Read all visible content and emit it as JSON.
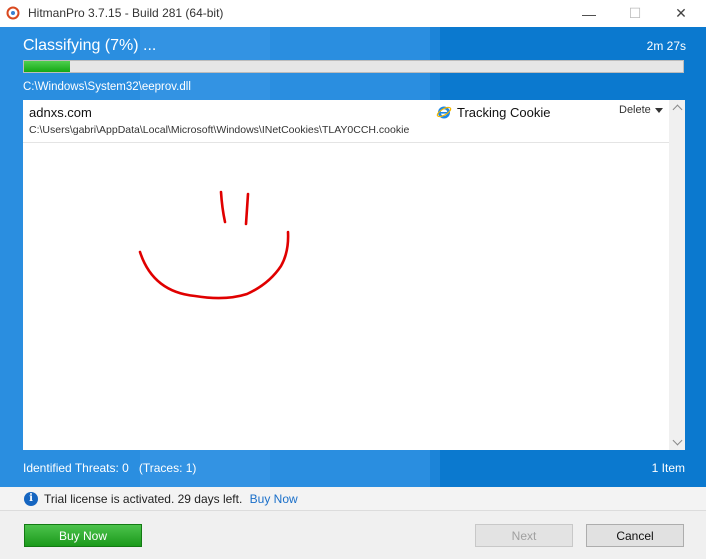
{
  "window": {
    "title": "HitmanPro 3.7.15 - Build 281 (64-bit)",
    "minimize_glyph": "—",
    "maximize_glyph": "☐",
    "close_glyph": "✕"
  },
  "scan": {
    "status": "Classifying (7%) ...",
    "progress_percent": 7,
    "time_remaining": "2m 27s",
    "current_file": "C:\\Windows\\System32\\eeprov.dll"
  },
  "results": [
    {
      "name": "adnxs.com",
      "path": "C:\\Users\\gabri\\AppData\\Local\\Microsoft\\Windows\\INetCookies\\TLAY0CCH.cookie",
      "type": "Tracking Cookie",
      "type_icon": "internet-explorer-icon",
      "action": "Delete"
    }
  ],
  "summary": {
    "threats": "Identified Threats: 0   (Traces: 1)",
    "item_count": "1 Item"
  },
  "notice": {
    "text": "Trial license is activated. 29 days left.",
    "link": "Buy Now",
    "icon": "info-icon"
  },
  "footer": {
    "buy_now": "Buy Now",
    "next": "Next",
    "cancel": "Cancel"
  },
  "colors": {
    "accent_blue": "#0b79cf",
    "progress_green": "#1ab01a",
    "buy_green": "#2ea82e",
    "link_blue": "#1a6fc9",
    "drawing_red": "#e00000"
  }
}
